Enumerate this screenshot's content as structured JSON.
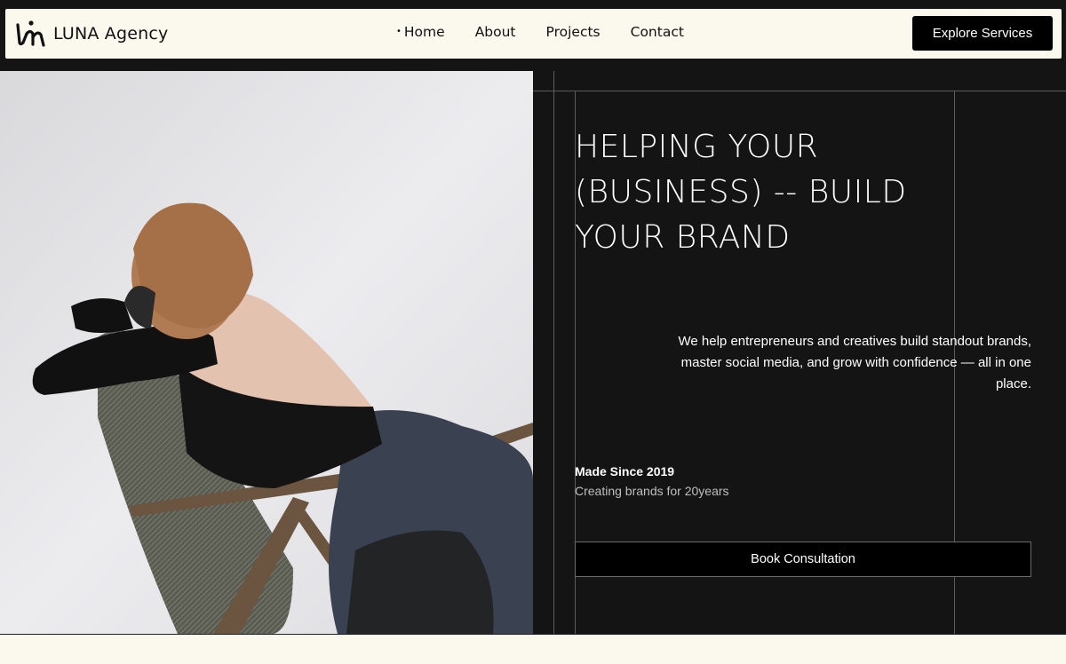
{
  "header": {
    "brand_name": "LUNA Agency",
    "logo_icon": "luna-logo-icon",
    "nav": [
      {
        "label": "Home",
        "active": true
      },
      {
        "label": "About",
        "active": false
      },
      {
        "label": "Projects",
        "active": false
      },
      {
        "label": "Contact",
        "active": false
      }
    ],
    "cta_label": "Explore Services"
  },
  "hero": {
    "image_icon": "hero-photo-woman-chair",
    "title": "HELPING YOUR (BUSINESS) -- BUILD YOUR BRAND",
    "description": "We help entrepreneurs and creatives build standout brands, master social media, and grow with confidence — all in one place.",
    "since_title": "Made Since 2019",
    "since_subtitle": "Creating brands for 20years",
    "book_label": "Book Consultation"
  },
  "colors": {
    "dark": "#141414",
    "cream": "#fbf8ee",
    "button": "#000000"
  }
}
